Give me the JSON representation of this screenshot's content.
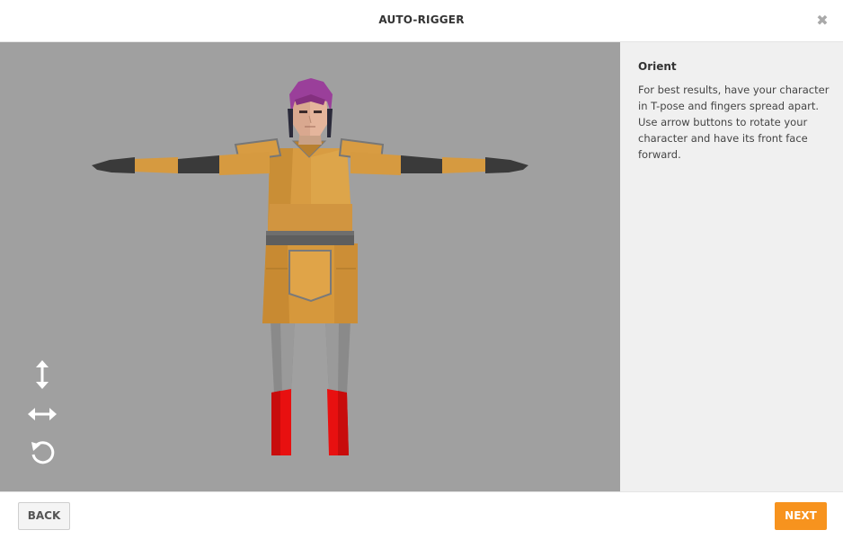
{
  "header": {
    "title": "AUTO-RIGGER",
    "close_glyph": "✖"
  },
  "viewport": {
    "background": "#a0a0a0",
    "tools": [
      {
        "name": "vertical-arrows-icon"
      },
      {
        "name": "horizontal-arrows-icon"
      },
      {
        "name": "rotate-icon"
      }
    ]
  },
  "panel": {
    "heading": "Orient",
    "description": "For best results, have your character in T-pose and fingers spread apart. Use arrow buttons to rotate your character and have its front face forward."
  },
  "footer": {
    "back_label": "BACK",
    "next_label": "NEXT"
  },
  "colors": {
    "accent": "#f7931e",
    "armor": "#d69a40",
    "hair": "#9a3f9a",
    "boots": "#e81010",
    "sleeves": "#3a3a3a",
    "legs": "#8c8c8c"
  }
}
